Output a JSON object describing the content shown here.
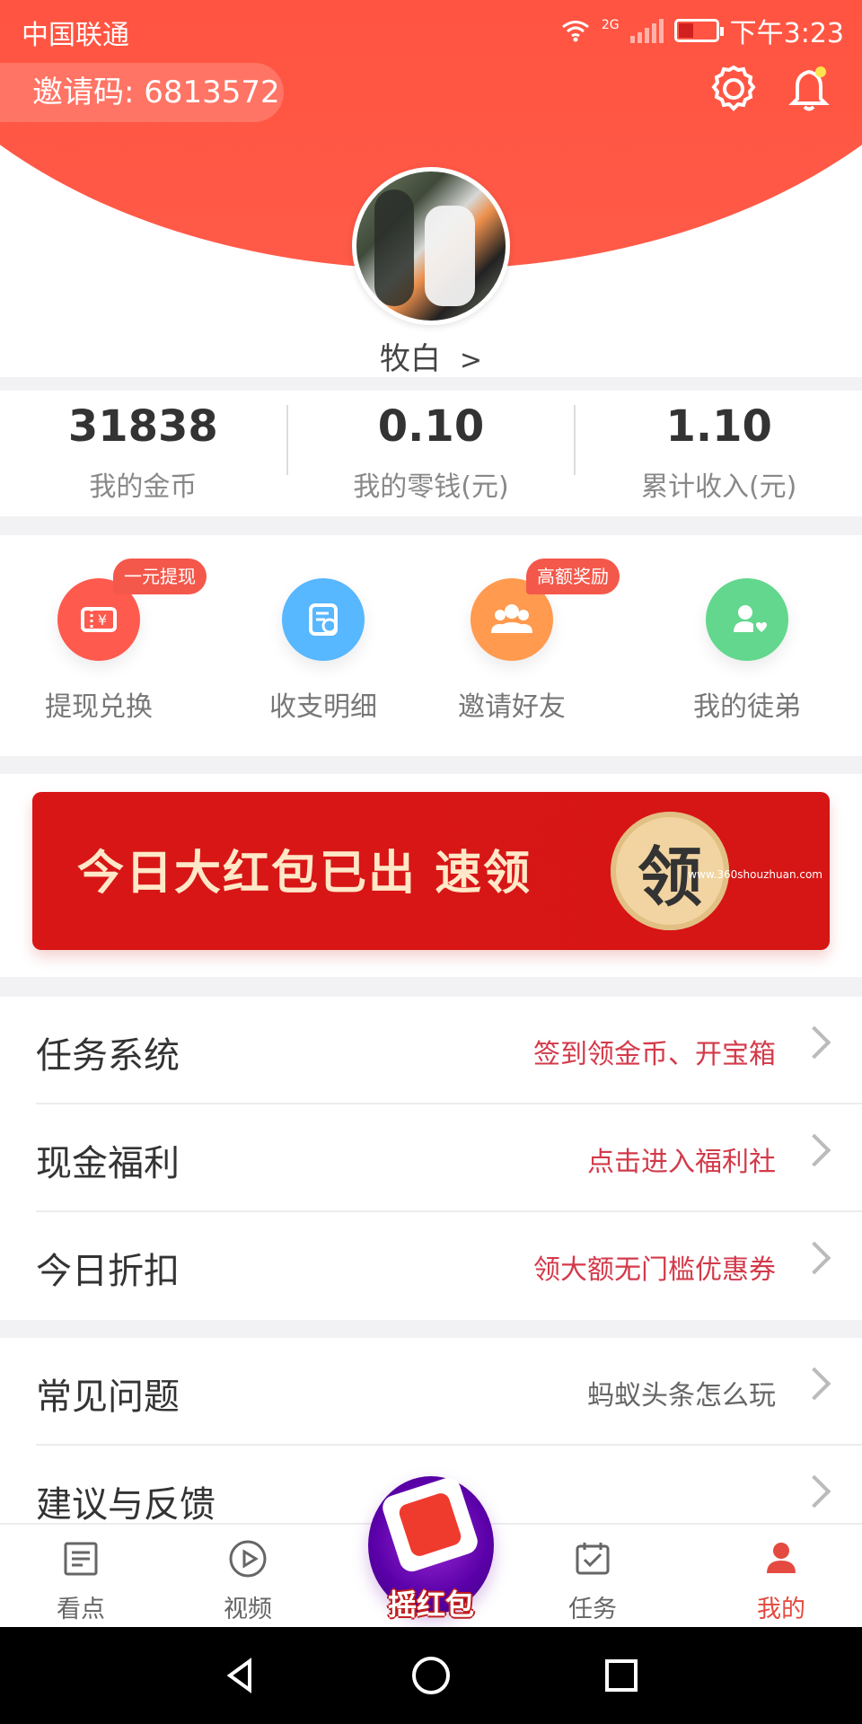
{
  "status_bar": {
    "carrier": "中国联通",
    "network": "2G",
    "time": "下午3:23"
  },
  "header": {
    "invite_code": "邀请码: 6813572",
    "settings_icon": "gear-icon",
    "notification_icon": "bell-icon"
  },
  "profile": {
    "name": "牧白",
    "avatar_icon": "avatar-photo"
  },
  "stats": [
    {
      "value": "31838",
      "label": "我的金币"
    },
    {
      "value": "0.10",
      "label": "我的零钱(元)"
    },
    {
      "value": "1.10",
      "label": "累计收入(元)"
    }
  ],
  "quick_actions": [
    {
      "label": "提现兑换",
      "badge": "一元提现",
      "icon": "ticket-icon",
      "color": "#ff5a4e"
    },
    {
      "label": "收支明细",
      "badge": "",
      "icon": "receipt-icon",
      "color": "#57b7ff"
    },
    {
      "label": "邀请好友",
      "badge": "高额奖励",
      "icon": "users-icon",
      "color": "#ff9a4f"
    },
    {
      "label": "我的徒弟",
      "badge": "",
      "icon": "user-heart-icon",
      "color": "#62d78d"
    }
  ],
  "banner": {
    "text": "今日大红包已出 速领",
    "button": "领",
    "watermark": "www.360shouzhuan.com"
  },
  "menu_group_1": [
    {
      "title": "任务系统",
      "subtitle": "签到领金币、开宝箱"
    },
    {
      "title": "现金福利",
      "subtitle": "点击进入福利社"
    },
    {
      "title": "今日折扣",
      "subtitle": "领大额无门槛优惠券"
    }
  ],
  "menu_group_2": [
    {
      "title": "常见问题",
      "subtitle": "蚂蚁头条怎么玩"
    },
    {
      "title": "建议与反馈",
      "subtitle": ""
    }
  ],
  "tabbar": [
    {
      "label": "看点",
      "icon": "newspaper-icon"
    },
    {
      "label": "视频",
      "icon": "play-icon"
    },
    {
      "label": "摇红包",
      "icon": "shake-red-packet-icon"
    },
    {
      "label": "任务",
      "icon": "calendar-check-icon"
    },
    {
      "label": "我的",
      "icon": "profile-icon"
    }
  ],
  "colors": {
    "primary": "#ff4a36",
    "accent": "#e44a3f",
    "text": "#333333"
  }
}
